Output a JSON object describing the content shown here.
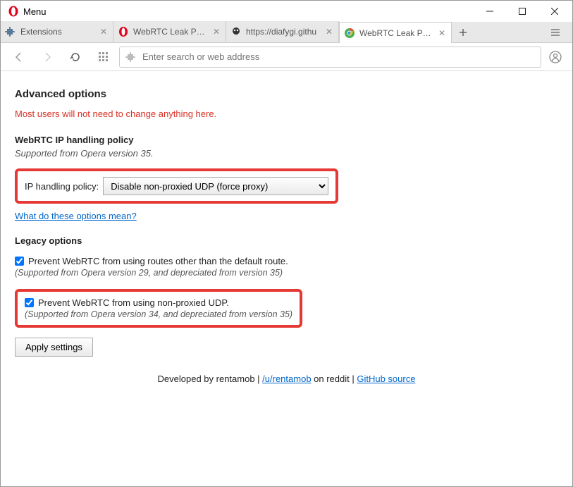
{
  "window": {
    "menu_label": "Menu"
  },
  "tabs": {
    "items": [
      {
        "title": "Extensions"
      },
      {
        "title": "WebRTC Leak Preven"
      },
      {
        "title": "https://diafygi.githu"
      },
      {
        "title": "WebRTC Leak Preven"
      }
    ]
  },
  "addressbar": {
    "placeholder": "Enter search or web address"
  },
  "page": {
    "h1": "Advanced options",
    "warning": "Most users will not need to change anything here.",
    "section1_heading": "WebRTC IP handling policy",
    "section1_supported": "Supported from Opera version 35.",
    "policy_label": "IP handling policy:",
    "policy_value": "Disable non-proxied UDP (force proxy)",
    "info_link": "What do these options mean?",
    "legacy_heading": "Legacy options",
    "legacy1_label": "Prevent WebRTC from using routes other than the default route.",
    "legacy1_depr": "(Supported from Opera version 29, and depreciated from version 35)",
    "legacy2_label": "Prevent WebRTC from using non-proxied UDP.",
    "legacy2_depr": "(Supported from Opera version 34, and depreciated from version 35)",
    "apply_button": "Apply settings",
    "footer_prefix": "Developed by rentamob | ",
    "footer_link1": "/u/rentamob",
    "footer_mid": " on reddit | ",
    "footer_link2": "GitHub source"
  }
}
